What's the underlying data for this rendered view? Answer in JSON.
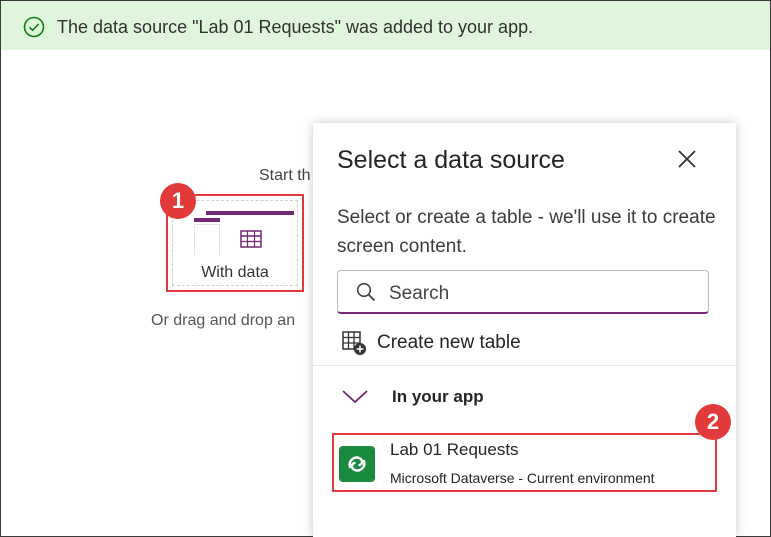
{
  "banner": {
    "message": "The data source \"Lab 01 Requests\" was added to your app.",
    "icon": "check-circle-icon",
    "background": "#dff6dd",
    "accent": "#107c10"
  },
  "canvas": {
    "start_text": "Start th",
    "tile_label": "With data",
    "drag_text": "Or drag and drop an",
    "badge_1": "1"
  },
  "panel": {
    "title": "Select a data source",
    "description": "Select or create a table - we'll use it to create screen content.",
    "search_placeholder": "Search",
    "create_label": "Create new table",
    "section_label": "In your app",
    "items": [
      {
        "name": "Lab 01 Requests",
        "subtitle": "Microsoft Dataverse - Current environment",
        "icon": "dataverse-icon"
      }
    ],
    "badge_2": "2"
  },
  "colors": {
    "brand": "#742774",
    "highlight": "#e0393e",
    "dataverse": "#1a8a3f"
  }
}
